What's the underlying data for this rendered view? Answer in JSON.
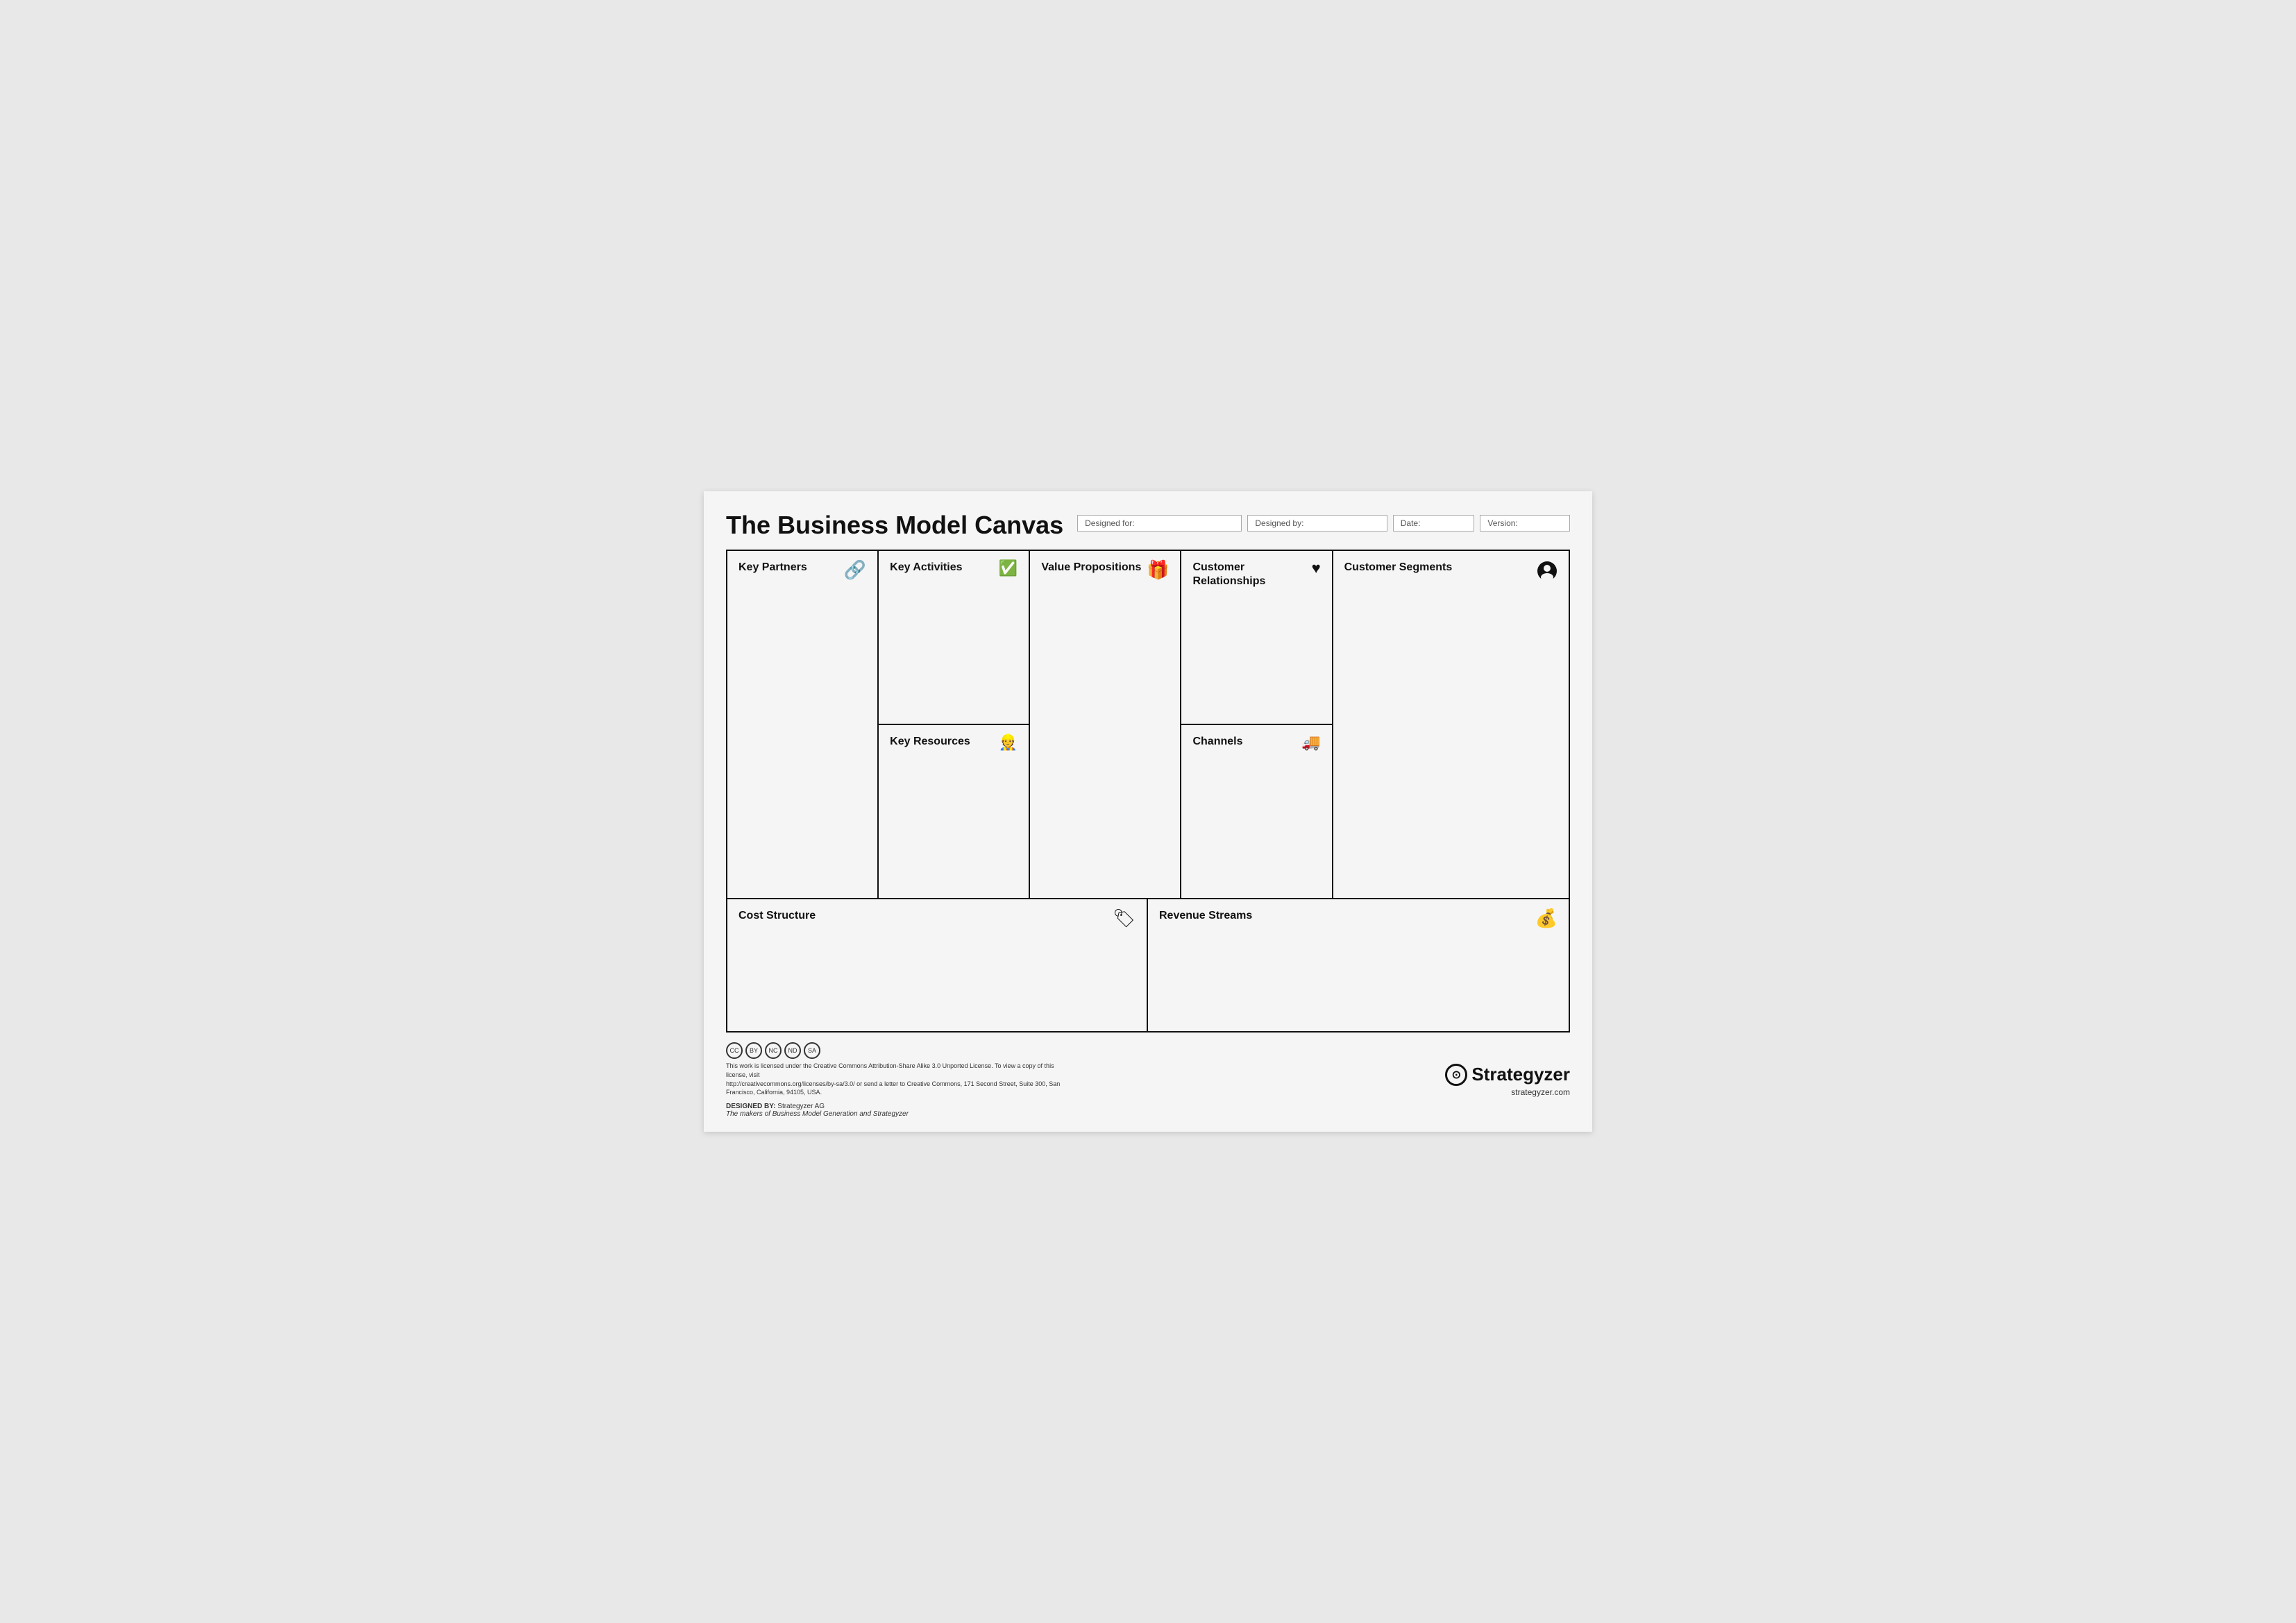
{
  "header": {
    "title": "The Business Model Canvas",
    "fields": [
      {
        "label": "Designed for:",
        "size": "wide"
      },
      {
        "label": "Designed by:",
        "size": "medium"
      },
      {
        "label": "Date:",
        "size": "narrow"
      },
      {
        "label": "Version:",
        "size": "xnarrow"
      }
    ]
  },
  "canvas": {
    "key_partners": {
      "title": "Key Partners",
      "icon": "🔗"
    },
    "key_activities": {
      "title": "Key Activities",
      "icon": "✅"
    },
    "key_resources": {
      "title": "Key Resources",
      "icon": "👷"
    },
    "value_propositions": {
      "title": "Value Propositions",
      "icon": "🎁"
    },
    "customer_relationships": {
      "title": "Customer Relationships",
      "icon": "♥"
    },
    "channels": {
      "title": "Channels",
      "icon": "🚚"
    },
    "customer_segments": {
      "title": "Customer Segments",
      "icon": "👤"
    },
    "cost_structure": {
      "title": "Cost Structure",
      "icon": "🏷"
    },
    "revenue_streams": {
      "title": "Revenue Streams",
      "icon": "💰"
    }
  },
  "footer": {
    "license_text": "This work is licensed under the Creative Commons Attribution-Share Alike 3.0 Unported License. To view a copy of this license, visit",
    "license_url": "http://creativecommons.org/licenses/by-sa/3.0/ or send a letter to Creative Commons, 171 Second Street, Suite 300, San Francisco, California, 94105, USA.",
    "designed_by_label": "DESIGNED BY:",
    "designed_by_value": "Strategyzer AG",
    "tagline": "The makers of Business Model Generation and Strategyzer",
    "brand": "Strategyzer",
    "url": "strategyzer.com"
  }
}
